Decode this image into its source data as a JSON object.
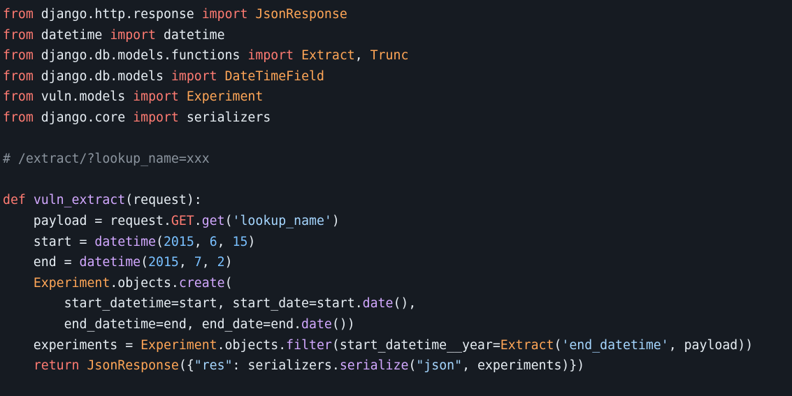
{
  "theme": {
    "background": "#161b22",
    "text": "#e6edf3",
    "keyword": "#ff7b72",
    "class": "#ffa657",
    "function": "#d2a8ff",
    "number": "#79c0ff",
    "string": "#a5d6ff",
    "comment": "#8b949e"
  },
  "code": {
    "language": "python",
    "lines": [
      [
        [
          "kw",
          "from"
        ],
        [
          "t",
          " django.http.response "
        ],
        [
          "kw",
          "import"
        ],
        [
          "t",
          " "
        ],
        [
          "cls",
          "JsonResponse"
        ]
      ],
      [
        [
          "kw",
          "from"
        ],
        [
          "t",
          " datetime "
        ],
        [
          "kw",
          "import"
        ],
        [
          "t",
          " datetime"
        ]
      ],
      [
        [
          "kw",
          "from"
        ],
        [
          "t",
          " django.db.models.functions "
        ],
        [
          "kw",
          "import"
        ],
        [
          "t",
          " "
        ],
        [
          "cls",
          "Extract"
        ],
        [
          "t",
          ", "
        ],
        [
          "cls",
          "Trunc"
        ]
      ],
      [
        [
          "kw",
          "from"
        ],
        [
          "t",
          " django.db.models "
        ],
        [
          "kw",
          "import"
        ],
        [
          "t",
          " "
        ],
        [
          "cls",
          "DateTimeField"
        ]
      ],
      [
        [
          "kw",
          "from"
        ],
        [
          "t",
          " vuln.models "
        ],
        [
          "kw",
          "import"
        ],
        [
          "t",
          " "
        ],
        [
          "cls",
          "Experiment"
        ]
      ],
      [
        [
          "kw",
          "from"
        ],
        [
          "t",
          " django.core "
        ],
        [
          "kw",
          "import"
        ],
        [
          "t",
          " serializers"
        ]
      ],
      [],
      [
        [
          "cmt",
          "# /extract/?lookup_name=xxx"
        ]
      ],
      [],
      [
        [
          "kw",
          "def"
        ],
        [
          "t",
          " "
        ],
        [
          "fn",
          "vuln_extract"
        ],
        [
          "t",
          "(request):"
        ]
      ],
      [
        [
          "t",
          "    payload = request."
        ],
        [
          "kw",
          "GET"
        ],
        [
          "t",
          "."
        ],
        [
          "fn",
          "get"
        ],
        [
          "t",
          "("
        ],
        [
          "str",
          "'lookup_name'"
        ],
        [
          "t",
          ")"
        ]
      ],
      [
        [
          "t",
          "    start = "
        ],
        [
          "fn",
          "datetime"
        ],
        [
          "t",
          "("
        ],
        [
          "num",
          "2015"
        ],
        [
          "t",
          ", "
        ],
        [
          "num",
          "6"
        ],
        [
          "t",
          ", "
        ],
        [
          "num",
          "15"
        ],
        [
          "t",
          ")"
        ]
      ],
      [
        [
          "t",
          "    end = "
        ],
        [
          "fn",
          "datetime"
        ],
        [
          "t",
          "("
        ],
        [
          "num",
          "2015"
        ],
        [
          "t",
          ", "
        ],
        [
          "num",
          "7"
        ],
        [
          "t",
          ", "
        ],
        [
          "num",
          "2"
        ],
        [
          "t",
          ")"
        ]
      ],
      [
        [
          "t",
          "    "
        ],
        [
          "cls",
          "Experiment"
        ],
        [
          "t",
          ".objects."
        ],
        [
          "fn",
          "create"
        ],
        [
          "t",
          "("
        ]
      ],
      [
        [
          "t",
          "        start_datetime=start, start_date=start."
        ],
        [
          "fn",
          "date"
        ],
        [
          "t",
          "(),"
        ]
      ],
      [
        [
          "t",
          "        end_datetime=end, end_date=end."
        ],
        [
          "fn",
          "date"
        ],
        [
          "t",
          "())"
        ]
      ],
      [
        [
          "t",
          "    experiments = "
        ],
        [
          "cls",
          "Experiment"
        ],
        [
          "t",
          ".objects."
        ],
        [
          "fn",
          "filter"
        ],
        [
          "t",
          "(start_datetime__year="
        ],
        [
          "cls",
          "Extract"
        ],
        [
          "t",
          "("
        ],
        [
          "str",
          "'end_datetime'"
        ],
        [
          "t",
          ", payload))"
        ]
      ],
      [
        [
          "t",
          "    "
        ],
        [
          "kw",
          "return"
        ],
        [
          "t",
          " "
        ],
        [
          "cls",
          "JsonResponse"
        ],
        [
          "t",
          "({"
        ],
        [
          "str",
          "\"res\""
        ],
        [
          "t",
          ": serializers."
        ],
        [
          "fn",
          "serialize"
        ],
        [
          "t",
          "("
        ],
        [
          "str",
          "\"json\""
        ],
        [
          "t",
          ", experiments)})"
        ]
      ]
    ]
  }
}
